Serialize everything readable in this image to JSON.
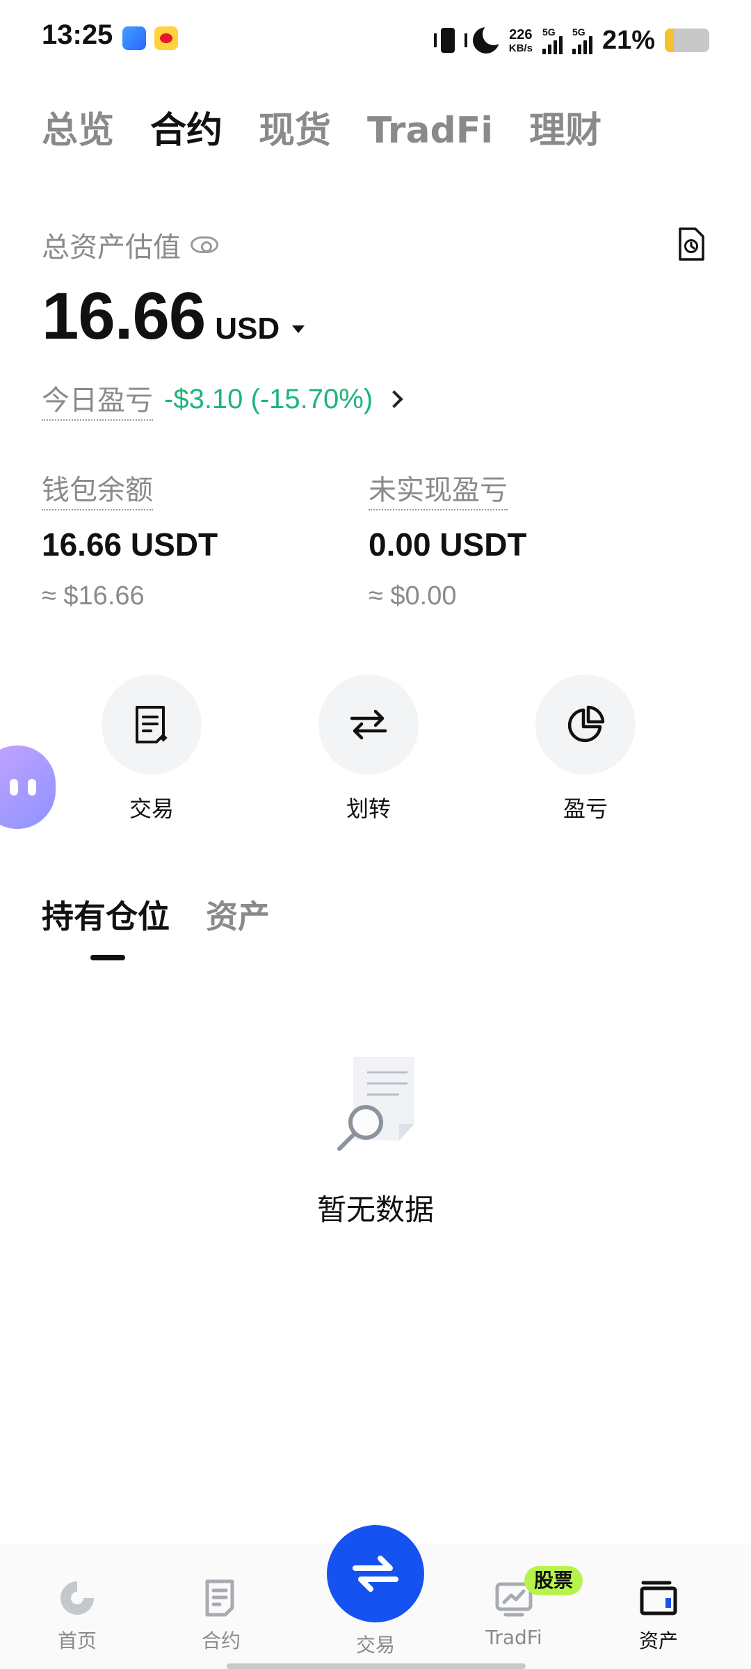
{
  "status_bar": {
    "time": "13:25",
    "net_speed_value": "226",
    "net_speed_unit": "KB/s",
    "sim1_label": "5G",
    "sim2_label": "5G",
    "battery_percent": "21%",
    "battery_level": 0.21,
    "icons": [
      "app-icon",
      "weibo-icon",
      "vibrate-icon",
      "moon-icon",
      "signal-icon",
      "signal-icon",
      "battery-icon"
    ]
  },
  "top_tabs": [
    {
      "label": "总览",
      "active": false
    },
    {
      "label": "合约",
      "active": true
    },
    {
      "label": "现货",
      "active": false
    },
    {
      "label": "TradFi",
      "active": false
    },
    {
      "label": "理财",
      "active": false
    }
  ],
  "summary": {
    "total_label": "总资产估值",
    "total_value": "16.66",
    "currency": "USD",
    "today_pnl_label": "今日盈亏",
    "today_pnl_value": "-$3.10 (-15.70%)",
    "pnl_color": "#1db579"
  },
  "balances": {
    "wallet": {
      "label": "钱包余额",
      "value": "16.66 USDT",
      "approx": "≈ $16.66"
    },
    "unrealized": {
      "label": "未实现盈亏",
      "value": "0.00 USDT",
      "approx": "≈ $0.00"
    }
  },
  "actions": [
    {
      "label": "交易",
      "icon": "trade-doc-icon"
    },
    {
      "label": "划转",
      "icon": "transfer-icon"
    },
    {
      "label": "盈亏",
      "icon": "pie-chart-icon"
    }
  ],
  "sub_tabs": [
    {
      "label": "持有仓位",
      "active": true
    },
    {
      "label": "资产",
      "active": false
    }
  ],
  "empty_state": {
    "text": "暂无数据"
  },
  "bottom_nav": {
    "items": [
      {
        "label": "首页",
        "icon": "home-icon"
      },
      {
        "label": "合约",
        "icon": "contract-icon"
      },
      {
        "label": "交易",
        "icon": "swap-icon"
      },
      {
        "label": "TradFi",
        "icon": "tradfi-icon"
      },
      {
        "label": "资产",
        "icon": "wallet-icon"
      }
    ],
    "badge": "股票",
    "accent": "#1652f0",
    "badge_color": "#b7f34a"
  }
}
